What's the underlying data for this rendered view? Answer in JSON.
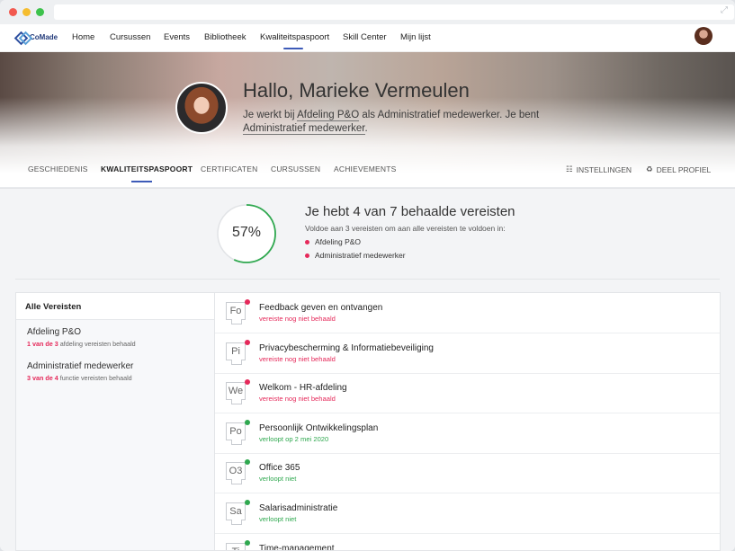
{
  "nav": {
    "logo_text": "CoMade",
    "items": [
      "Home",
      "Cursussen",
      "Events",
      "Bibliotheek",
      "Kwaliteitspaspoort",
      "Skill Center",
      "Mijn lijst"
    ],
    "active_index": 4
  },
  "hero": {
    "greeting": "Hallo, Marieke Vermeulen",
    "line_prefix": "Je werkt bij",
    "department": "Afdeling P&O",
    "line_middle": "als Administratief medewerker. Je bent",
    "role": "Administratief medewerker",
    "line_suffix": "."
  },
  "tabs": {
    "items": [
      "GESCHIEDENIS",
      "KWALITEITSPASPOORT",
      "CERTIFICATEN",
      "CURSUSSEN",
      "ACHIEVEMENTS"
    ],
    "active_index": 1,
    "settings": "INSTELLINGEN",
    "share": "DEEL PROFIEL"
  },
  "summary": {
    "percent": "57%",
    "progress_fraction": 0.57,
    "title": "Je hebt 4 van 7 behaalde vereisten",
    "subtitle": "Voldoe aan 3 vereisten om aan alle vereisten te voldoen in:",
    "items": [
      "Afdeling P&O",
      "Administratief medewerker"
    ]
  },
  "left_panel": {
    "title": "Alle Vereisten",
    "groups": [
      {
        "title": "Afdeling P&O",
        "count": "1 van de 3",
        "rest": "afdeling vereisten behaald"
      },
      {
        "title": "Administratief medewerker",
        "count": "3 van de 4",
        "rest": "functie vereisten behaald"
      }
    ]
  },
  "requirements": [
    {
      "abbr": "Fo",
      "title": "Feedback geven en ontvangen",
      "status": "vereiste nog niet behaald",
      "state": "red"
    },
    {
      "abbr": "Pi",
      "title": "Privacybescherming & Informatiebeveiliging",
      "status": "vereiste nog niet behaald",
      "state": "red"
    },
    {
      "abbr": "We",
      "title": "Welkom - HR-afdeling",
      "status": "vereiste nog niet behaald",
      "state": "red"
    },
    {
      "abbr": "Po",
      "title": "Persoonlijk Ontwikkelingsplan",
      "status": "verloopt op 2 mei 2020",
      "state": "green"
    },
    {
      "abbr": "O3",
      "title": "Office 365",
      "status": "verloopt niet",
      "state": "green"
    },
    {
      "abbr": "Sa",
      "title": "Salarisadministratie",
      "status": "verloopt niet",
      "state": "green"
    },
    {
      "abbr": "Ti",
      "title": "Time-management",
      "status": "",
      "state": "green"
    }
  ],
  "colors": {
    "accent": "#3d5bb8",
    "red": "#e5295a",
    "green": "#2fa84f"
  }
}
